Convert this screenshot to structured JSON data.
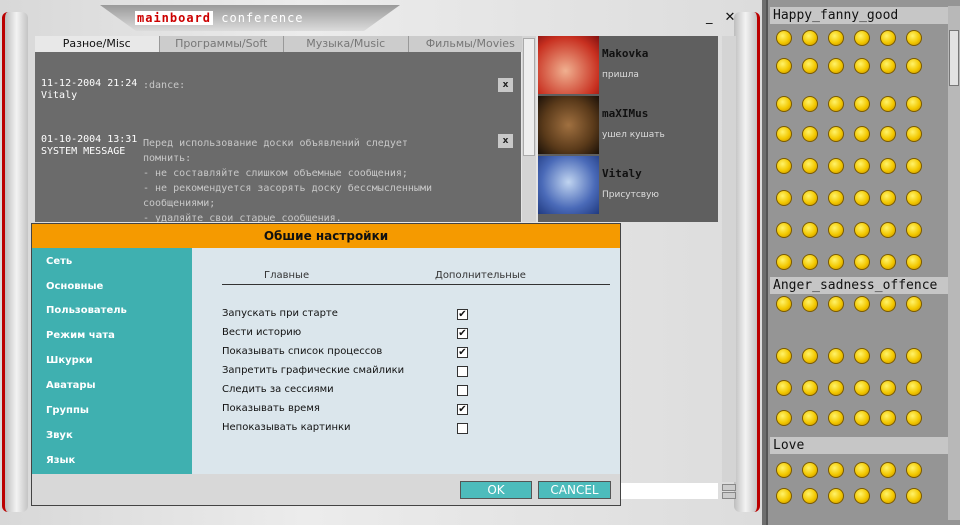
{
  "window": {
    "title_bold": "mainboard",
    "title_rest": "conference",
    "minimize": "_",
    "close": "✕"
  },
  "tabs": [
    "Разное/Misc",
    "Программы/Soft",
    "Музыка/Music",
    "Фильмы/Movies"
  ],
  "messages": [
    {
      "date": "11-12-2004 21:24",
      "author": "Vitaly",
      "text": ":dance:",
      "delete": "x"
    },
    {
      "date": "01-10-2004 13:31",
      "author": "SYSTEM MESSAGE",
      "text": "Перед использование доски объявлений следует\nпомнить:\n- не составляйте слишком объемные сообщения;\n- не рекомендуется засорять доску бессмысленными\nсообщениями;\n- удаляйте свои старые сообщения.",
      "delete": "x"
    }
  ],
  "users": [
    {
      "name": "Makovka",
      "status": "пришла",
      "color": "#c83020"
    },
    {
      "name": "maXIMus",
      "status": "ушел кушать",
      "color": "#5a3a1a"
    },
    {
      "name": "Vitaly",
      "status": "Присутсвую",
      "color": "#4a6ab8"
    }
  ],
  "dialog": {
    "title": "Обшие настройки",
    "nav": [
      "Сеть",
      "Основные",
      "Пользователь",
      "Режим чата",
      "Шкурки",
      "Аватары",
      "Группы",
      "Звук",
      "Язык"
    ],
    "tab_main": "Главные",
    "tab_extra": "Дополнительные",
    "options": [
      {
        "label": "Запускать при старте",
        "checked": true
      },
      {
        "label": "Вести историю",
        "checked": true
      },
      {
        "label": "Показывать список процессов",
        "checked": true
      },
      {
        "label": "Запретить графические смайлики",
        "checked": false
      },
      {
        "label": "Следить за сессиями",
        "checked": false
      },
      {
        "label": "Показывать время",
        "checked": true
      },
      {
        "label": "Непоказывать картинки",
        "checked": false
      }
    ],
    "ok": "OK",
    "cancel": "CANCEL",
    "colors": {
      "title": "#f59a00",
      "nav": "#3fb0b0",
      "button": "#4dbcbc"
    }
  },
  "smiley_categories": [
    "Happy_fanny_good",
    "Anger_sadness_offence",
    "Love"
  ]
}
